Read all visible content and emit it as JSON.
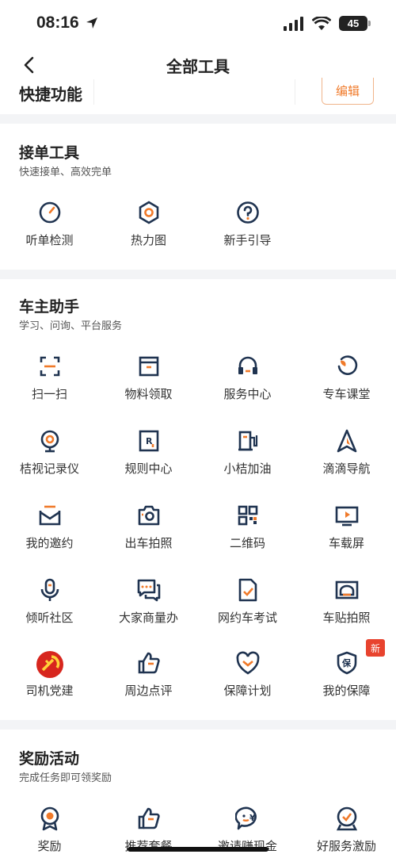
{
  "status_bar": {
    "time": "08:16",
    "battery": "45"
  },
  "nav": {
    "title": "全部工具"
  },
  "quick": {
    "title": "快捷功能",
    "edit_label": "编辑"
  },
  "sections": [
    {
      "title": "接单工具",
      "subtitle": "快速接单、高效完单",
      "items": [
        {
          "label": "听单检测",
          "icon": "gauge-icon"
        },
        {
          "label": "热力图",
          "icon": "heatmap-icon"
        },
        {
          "label": "新手引导",
          "icon": "question-icon"
        }
      ]
    },
    {
      "title": "车主助手",
      "subtitle": "学习、问询、平台服务",
      "items": [
        {
          "label": "扫一扫",
          "icon": "scan-icon"
        },
        {
          "label": "物料领取",
          "icon": "materials-icon"
        },
        {
          "label": "服务中心",
          "icon": "headset-icon"
        },
        {
          "label": "专车课堂",
          "icon": "classroom-icon"
        },
        {
          "label": "桔视记录仪",
          "icon": "camera-recorder-icon"
        },
        {
          "label": "规则中心",
          "icon": "rules-icon"
        },
        {
          "label": "小桔加油",
          "icon": "fuel-icon"
        },
        {
          "label": "滴滴导航",
          "icon": "navigation-icon"
        },
        {
          "label": "我的邀约",
          "icon": "envelope-icon"
        },
        {
          "label": "出车拍照",
          "icon": "photo-camera-icon"
        },
        {
          "label": "二维码",
          "icon": "qr-code-icon"
        },
        {
          "label": "车载屏",
          "icon": "car-screen-icon"
        },
        {
          "label": "倾听社区",
          "icon": "microphone-icon"
        },
        {
          "label": "大家商量办",
          "icon": "chat-icon"
        },
        {
          "label": "网约车考试",
          "icon": "exam-icon"
        },
        {
          "label": "车贴拍照",
          "icon": "car-sticker-icon"
        },
        {
          "label": "司机党建",
          "icon": "party-emblem-icon"
        },
        {
          "label": "周边点评",
          "icon": "thumbs-up-icon"
        },
        {
          "label": "保障计划",
          "icon": "heart-shield-icon"
        },
        {
          "label": "我的保障",
          "icon": "protection-icon"
        }
      ],
      "new_badge": "新"
    },
    {
      "title": "奖励活动",
      "subtitle": "完成任务即可领奖励",
      "items": [
        {
          "label": "奖励",
          "icon": "medal-icon"
        },
        {
          "label": "推荐套餐",
          "icon": "recommend-icon"
        },
        {
          "label": "邀请赚现金",
          "icon": "cash-chat-icon"
        },
        {
          "label": "好服务激励",
          "icon": "badge-check-icon"
        }
      ]
    }
  ],
  "colors": {
    "navy": "#1f3350",
    "orange": "#f07a2a",
    "red": "#e8432e",
    "bg_gap": "#f3f4f6"
  }
}
